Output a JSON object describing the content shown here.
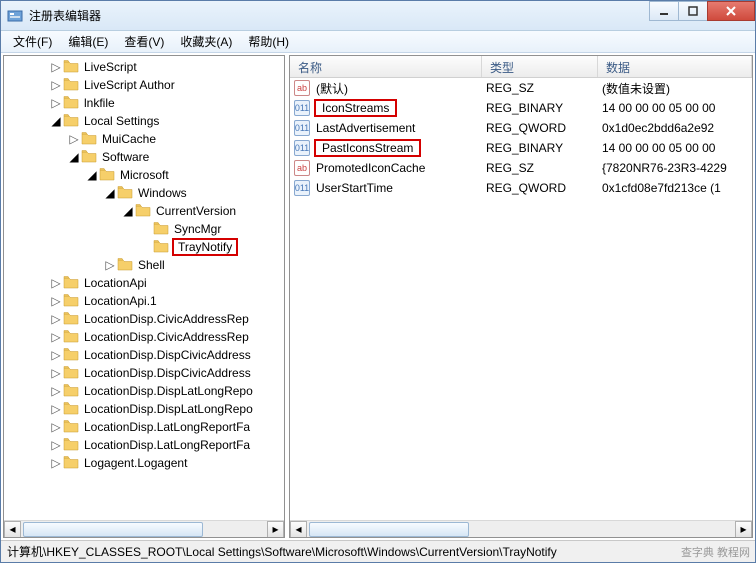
{
  "window": {
    "title": "注册表编辑器"
  },
  "menu": {
    "file": "文件(F)",
    "edit": "编辑(E)",
    "view": "查看(V)",
    "favorites": "收藏夹(A)",
    "help": "帮助(H)"
  },
  "tree": [
    {
      "indent": 44,
      "twisty": "closed",
      "label": "LiveScript"
    },
    {
      "indent": 44,
      "twisty": "closed",
      "label": "LiveScript Author"
    },
    {
      "indent": 44,
      "twisty": "closed",
      "label": "lnkfile"
    },
    {
      "indent": 44,
      "twisty": "open",
      "label": "Local Settings"
    },
    {
      "indent": 62,
      "twisty": "closed",
      "label": "MuiCache"
    },
    {
      "indent": 62,
      "twisty": "open",
      "label": "Software"
    },
    {
      "indent": 80,
      "twisty": "open",
      "label": "Microsoft"
    },
    {
      "indent": 98,
      "twisty": "open",
      "label": "Windows"
    },
    {
      "indent": 116,
      "twisty": "open",
      "label": "CurrentVersion"
    },
    {
      "indent": 134,
      "twisty": "none",
      "label": "SyncMgr"
    },
    {
      "indent": 134,
      "twisty": "none",
      "label": "TrayNotify",
      "selected": true
    },
    {
      "indent": 98,
      "twisty": "closed",
      "label": "Shell"
    },
    {
      "indent": 44,
      "twisty": "closed",
      "label": "LocationApi"
    },
    {
      "indent": 44,
      "twisty": "closed",
      "label": "LocationApi.1"
    },
    {
      "indent": 44,
      "twisty": "closed",
      "label": "LocationDisp.CivicAddressRep"
    },
    {
      "indent": 44,
      "twisty": "closed",
      "label": "LocationDisp.CivicAddressRep"
    },
    {
      "indent": 44,
      "twisty": "closed",
      "label": "LocationDisp.DispCivicAddress"
    },
    {
      "indent": 44,
      "twisty": "closed",
      "label": "LocationDisp.DispCivicAddress"
    },
    {
      "indent": 44,
      "twisty": "closed",
      "label": "LocationDisp.DispLatLongRepo"
    },
    {
      "indent": 44,
      "twisty": "closed",
      "label": "LocationDisp.DispLatLongRepo"
    },
    {
      "indent": 44,
      "twisty": "closed",
      "label": "LocationDisp.LatLongReportFa"
    },
    {
      "indent": 44,
      "twisty": "closed",
      "label": "LocationDisp.LatLongReportFa"
    },
    {
      "indent": 44,
      "twisty": "closed",
      "label": "Logagent.Logagent"
    }
  ],
  "columns": {
    "name": "名称",
    "type": "类型",
    "data": "数据"
  },
  "values": [
    {
      "icon": "sz",
      "name": "(默认)",
      "type": "REG_SZ",
      "data": "(数值未设置)"
    },
    {
      "icon": "bin",
      "name": "IconStreams",
      "type": "REG_BINARY",
      "data": "14 00 00 00 05 00 00",
      "hl": true
    },
    {
      "icon": "bin",
      "name": "LastAdvertisement",
      "type": "REG_QWORD",
      "data": "0x1d0ec2bdd6a2e92"
    },
    {
      "icon": "bin",
      "name": "PastIconsStream",
      "type": "REG_BINARY",
      "data": "14 00 00 00 05 00 00",
      "hl": true
    },
    {
      "icon": "sz",
      "name": "PromotedIconCache",
      "type": "REG_SZ",
      "data": "{7820NR76-23R3-4229"
    },
    {
      "icon": "bin",
      "name": "UserStartTime",
      "type": "REG_QWORD",
      "data": "0x1cfd08e7fd213ce (1"
    }
  ],
  "status": {
    "path": "计算机\\HKEY_CLASSES_ROOT\\Local Settings\\Software\\Microsoft\\Windows\\CurrentVersion\\TrayNotify"
  },
  "watermark": "查字典 教程网"
}
